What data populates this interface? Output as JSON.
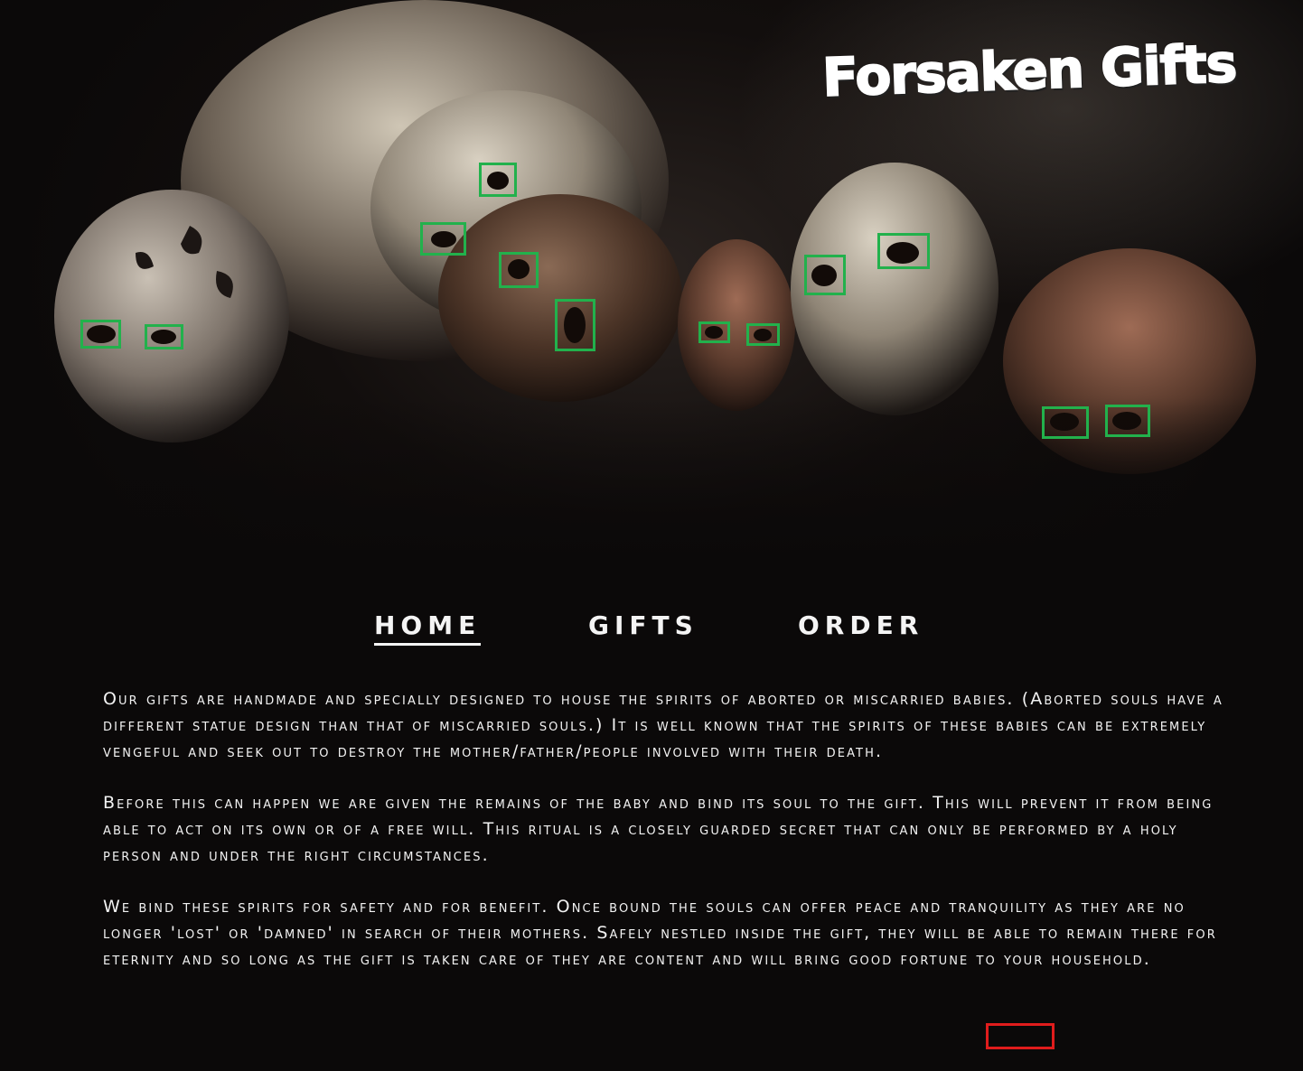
{
  "site": {
    "logo_text": "Forsaken Gifts"
  },
  "nav": {
    "items": [
      {
        "label": "HOME",
        "active": true
      },
      {
        "label": "GIFTS",
        "active": false
      },
      {
        "label": "ORDER",
        "active": false
      }
    ]
  },
  "content": {
    "paragraphs": [
      "Our gifts are handmade and specially designed to house the spirits of aborted or miscarried babies. (Aborted souls have a different statue design than that of miscarried souls.) It is well known that the spirits of these babies can be extremely vengeful and seek out to destroy the mother/father/people involved with their death.",
      "Before this can happen we are given the remains of the baby and bind its soul to the gift. This will prevent it from being able to act on its own or of a free will. This ritual is a closely guarded secret that can only be performed by a holy person and under the right circumstances.",
      "We bind these spirits for safety and for benefit. Once bound the souls can offer peace and tranquility as they are no longer 'lost' or 'damned' in search of their mothers. Safely nestled inside the gift, they will be able to remain there for eternity and so long as the gift is taken care of they are content and will bring good fortune to your household."
    ]
  },
  "colors": {
    "background": "#0b0909",
    "text": "#f2f2f2",
    "annotation_green": "#22b14c",
    "annotation_red": "#e01c1c"
  }
}
